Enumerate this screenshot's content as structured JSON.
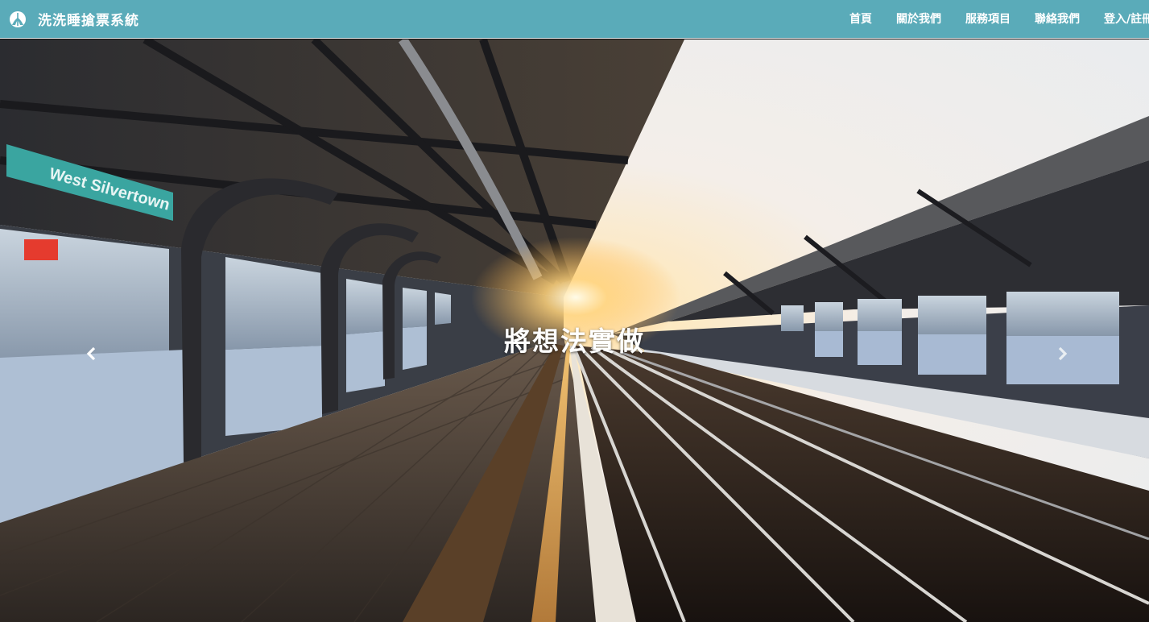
{
  "brand": {
    "title": "洗洗睡搶票系統",
    "icon": "train-logo-icon"
  },
  "nav": {
    "items": [
      {
        "label": "首頁"
      },
      {
        "label": "關於我們"
      },
      {
        "label": "服務項目"
      },
      {
        "label": "聯絡我們"
      },
      {
        "label": "登入/註冊"
      }
    ]
  },
  "carousel": {
    "caption": "將想法實做",
    "prev_icon": "chevron-left-icon",
    "next_icon": "chevron-right-icon"
  },
  "colors": {
    "navbar": "#5aabb9",
    "text": "#ffffff"
  }
}
